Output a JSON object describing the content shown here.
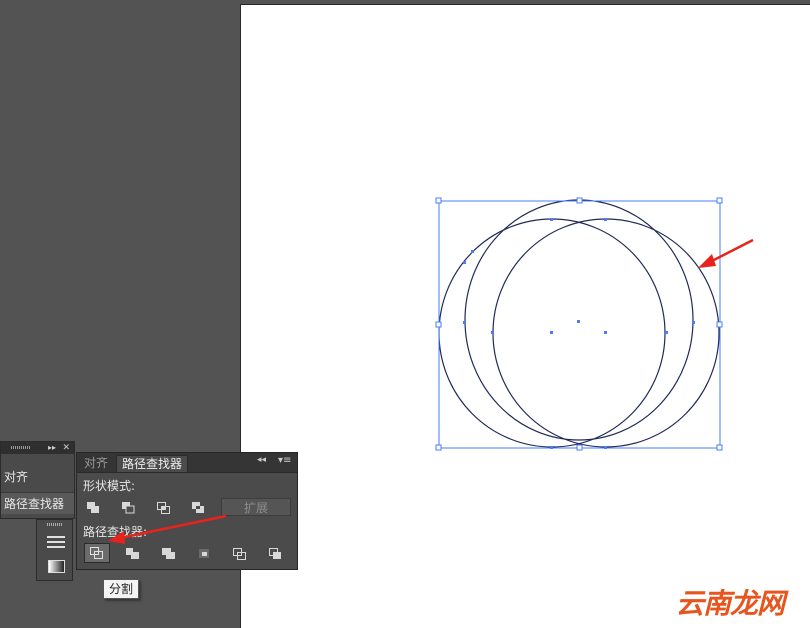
{
  "mini_panel": {
    "items": [
      "对齐",
      "路径查找器"
    ]
  },
  "pathfinder": {
    "tabs": [
      "对齐",
      "路径查找器"
    ],
    "shape_modes_label": "形状模式:",
    "shape_mode_buttons": [
      "unite-icon",
      "minus-front-icon",
      "intersect-icon",
      "exclude-icon"
    ],
    "expand_label": "扩展",
    "pathfinders_label": "路径查找器:",
    "pathfinder_buttons": [
      "divide-icon",
      "trim-icon",
      "merge-icon",
      "crop-icon",
      "outline-icon",
      "minus-back-icon"
    ]
  },
  "tooltip": {
    "text": "分割"
  },
  "watermark": {
    "text": "云南龙网"
  },
  "colors": {
    "selection": "#4a7bff",
    "arrow": "#e8231c",
    "panel": "#4b4b4b",
    "pasteboard": "#535353"
  }
}
